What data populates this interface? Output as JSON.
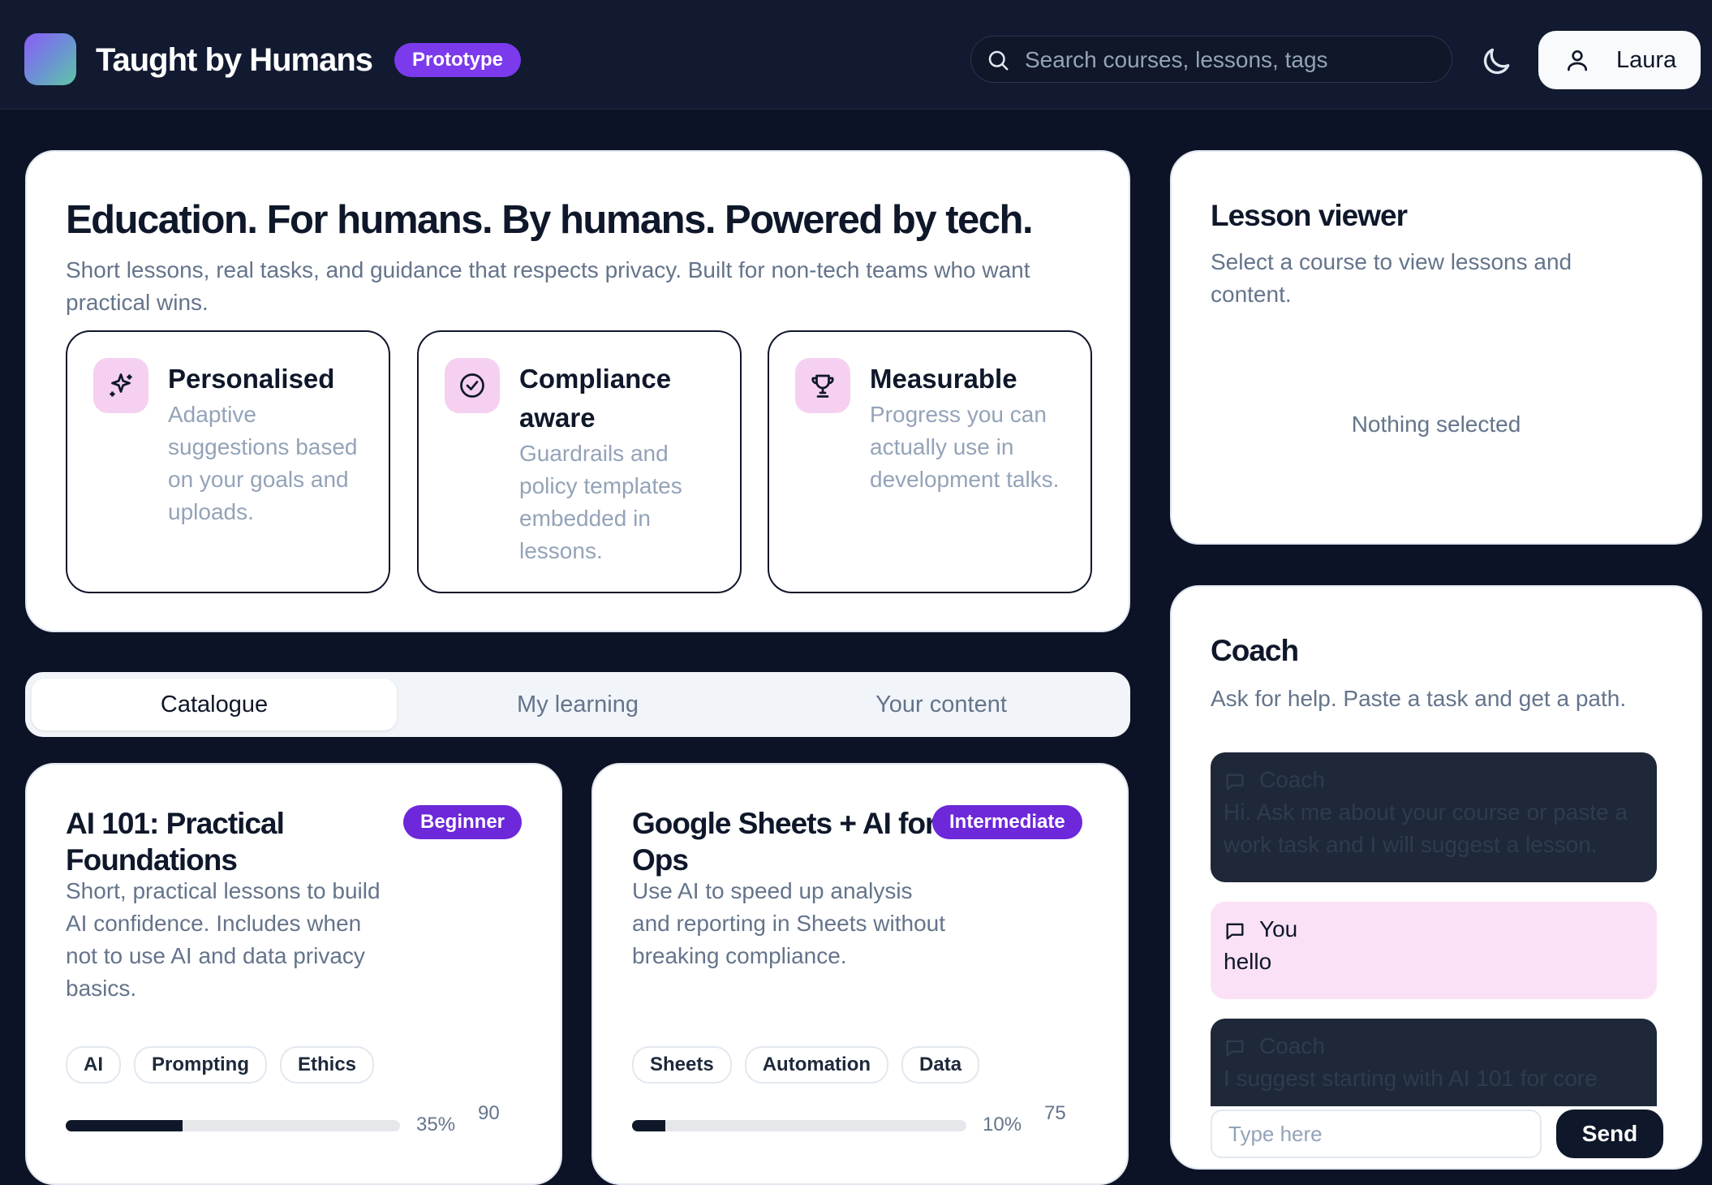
{
  "header": {
    "brand": "Taught by Humans",
    "badge": "Prototype",
    "search_placeholder": "Search courses, lessons, tags",
    "user_name": "Laura"
  },
  "hero": {
    "title": "Education. For humans. By humans. Powered by tech.",
    "subtitle": "Short lessons, real tasks, and guidance that respects privacy. Built for non-tech teams who want practical wins.",
    "features": [
      {
        "icon": "sparkles-icon",
        "title": "Personalised",
        "desc": "Adaptive suggestions based on your goals and uploads."
      },
      {
        "icon": "check-circle-icon",
        "title": "Compliance aware",
        "desc": "Guardrails and policy templates embedded in lessons."
      },
      {
        "icon": "trophy-icon",
        "title": "Measurable",
        "desc": "Progress you can actually use in development talks."
      }
    ]
  },
  "tabs": [
    {
      "label": "Catalogue",
      "active": true
    },
    {
      "label": "My learning",
      "active": false
    },
    {
      "label": "Your content",
      "active": false
    }
  ],
  "courses": [
    {
      "title": "AI 101: Practical Foundations",
      "level": "Beginner",
      "desc": "Short, practical lessons to build AI confidence. Includes when not to use AI and data privacy basics.",
      "tags": [
        "AI",
        "Prompting",
        "Ethics"
      ],
      "progress_label": "35%",
      "progress": 0.35,
      "minutes": "90"
    },
    {
      "title": "Google Sheets + AI for Ops",
      "level": "Intermediate",
      "desc": "Use AI to speed up analysis and reporting in Sheets without breaking compliance.",
      "tags": [
        "Sheets",
        "Automation",
        "Data"
      ],
      "progress_label": "10%",
      "progress": 0.1,
      "minutes": "75"
    }
  ],
  "viewer": {
    "title": "Lesson viewer",
    "subtitle": "Select a course to view lessons and content.",
    "empty": "Nothing selected"
  },
  "coach": {
    "title": "Coach",
    "subtitle": "Ask for help. Paste a task and get a path.",
    "messages": [
      {
        "role": "bot",
        "author": "Coach",
        "text": "Hi. Ask me about your course or paste a work task and I will suggest a lesson."
      },
      {
        "role": "me",
        "author": "You",
        "text": "hello"
      },
      {
        "role": "bot",
        "author": "Coach",
        "text": "I suggest starting with AI 101 for core"
      }
    ],
    "input_placeholder": "Type here",
    "send_label": "Send"
  },
  "colors": {
    "background": "#0d1326",
    "accent": "#7c3aed",
    "feature_icon_bg": "#f5d0f0",
    "user_message_bg": "#fbe1f6"
  }
}
